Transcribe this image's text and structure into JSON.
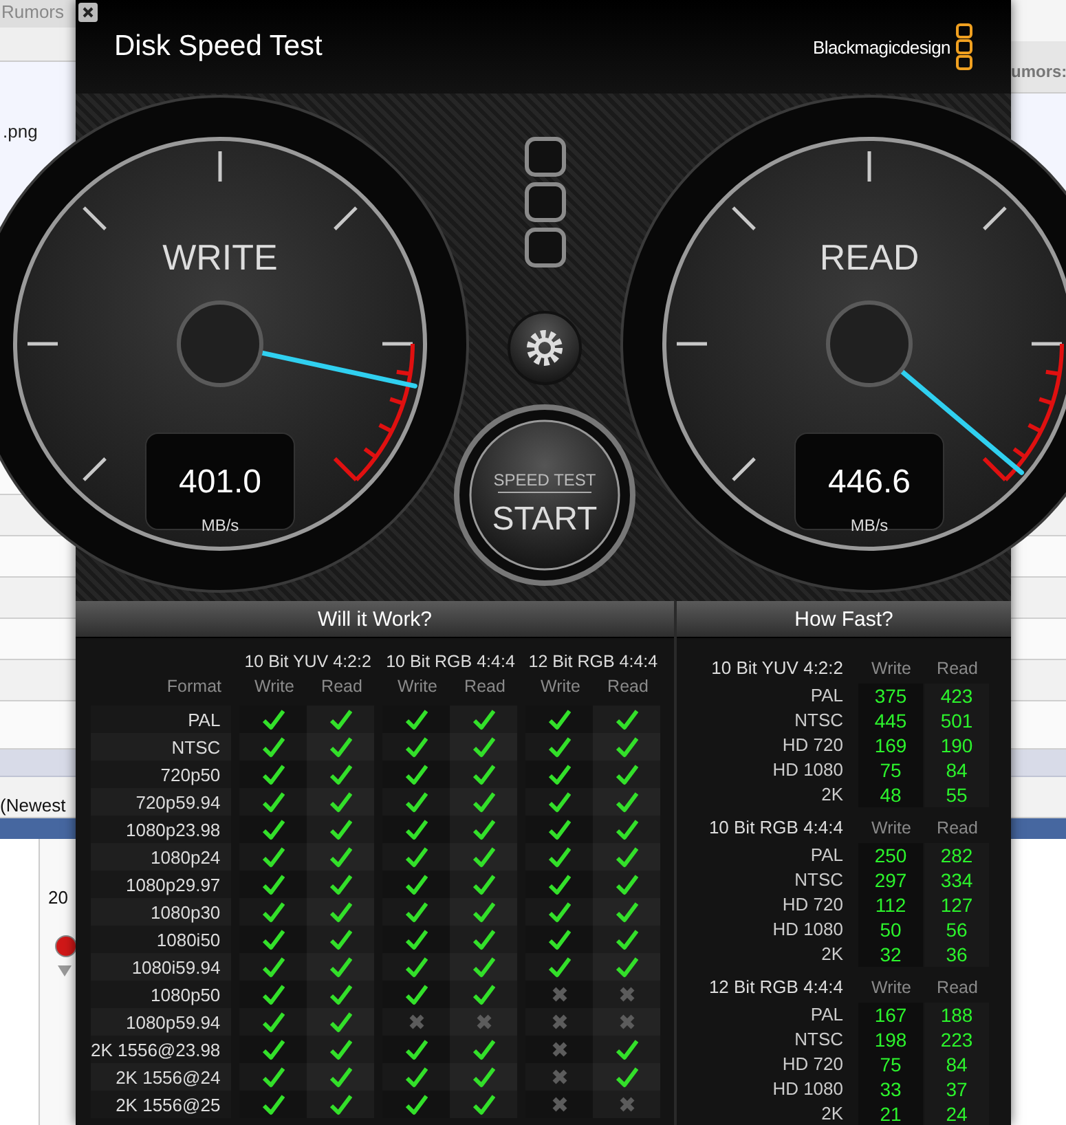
{
  "background_browser": {
    "tab_title": "Rumors",
    "file_name": ".png",
    "sort_label": "(Newest",
    "year_text": "20",
    "right_label": "umors:"
  },
  "window": {
    "title": "Disk Speed Test",
    "brand": "Blackmagicdesign"
  },
  "gauges": [
    {
      "label": "WRITE",
      "reading": "401.0",
      "unit": "MB/s"
    },
    {
      "label": "READ",
      "reading": "446.6",
      "unit": "MB/s"
    }
  ],
  "start_button": {
    "caption": "SPEED TEST",
    "label": "START"
  },
  "will_it_work": {
    "title": "Will it Work?",
    "format_header": "Format",
    "groups": [
      {
        "name": "10 Bit YUV 4:2:2",
        "columns": [
          "Write",
          "Read"
        ]
      },
      {
        "name": "10 Bit RGB 4:4:4",
        "columns": [
          "Write",
          "Read"
        ]
      },
      {
        "name": "12 Bit RGB 4:4:4",
        "columns": [
          "Write",
          "Read"
        ]
      }
    ],
    "rows": [
      {
        "format": "PAL",
        "results": [
          true,
          true,
          true,
          true,
          true,
          true
        ]
      },
      {
        "format": "NTSC",
        "results": [
          true,
          true,
          true,
          true,
          true,
          true
        ]
      },
      {
        "format": "720p50",
        "results": [
          true,
          true,
          true,
          true,
          true,
          true
        ]
      },
      {
        "format": "720p59.94",
        "results": [
          true,
          true,
          true,
          true,
          true,
          true
        ]
      },
      {
        "format": "1080p23.98",
        "results": [
          true,
          true,
          true,
          true,
          true,
          true
        ]
      },
      {
        "format": "1080p24",
        "results": [
          true,
          true,
          true,
          true,
          true,
          true
        ]
      },
      {
        "format": "1080p29.97",
        "results": [
          true,
          true,
          true,
          true,
          true,
          true
        ]
      },
      {
        "format": "1080p30",
        "results": [
          true,
          true,
          true,
          true,
          true,
          true
        ]
      },
      {
        "format": "1080i50",
        "results": [
          true,
          true,
          true,
          true,
          true,
          true
        ]
      },
      {
        "format": "1080i59.94",
        "results": [
          true,
          true,
          true,
          true,
          true,
          true
        ]
      },
      {
        "format": "1080p50",
        "results": [
          true,
          true,
          true,
          true,
          false,
          false
        ]
      },
      {
        "format": "1080p59.94",
        "results": [
          true,
          true,
          false,
          false,
          false,
          false
        ]
      },
      {
        "format": "2K 1556@23.98",
        "results": [
          true,
          true,
          true,
          true,
          false,
          true
        ]
      },
      {
        "format": "2K 1556@24",
        "results": [
          true,
          true,
          true,
          true,
          false,
          true
        ]
      },
      {
        "format": "2K 1556@25",
        "results": [
          true,
          true,
          true,
          true,
          false,
          false
        ]
      }
    ]
  },
  "how_fast": {
    "title": "How Fast?",
    "groups": [
      {
        "name": "10 Bit YUV 4:2:2",
        "write_header": "Write",
        "read_header": "Read",
        "rows": [
          {
            "format": "PAL",
            "write": "375",
            "read": "423"
          },
          {
            "format": "NTSC",
            "write": "445",
            "read": "501"
          },
          {
            "format": "HD 720",
            "write": "169",
            "read": "190"
          },
          {
            "format": "HD 1080",
            "write": "75",
            "read": "84"
          },
          {
            "format": "2K",
            "write": "48",
            "read": "55"
          }
        ]
      },
      {
        "name": "10 Bit RGB 4:4:4",
        "write_header": "Write",
        "read_header": "Read",
        "rows": [
          {
            "format": "PAL",
            "write": "250",
            "read": "282"
          },
          {
            "format": "NTSC",
            "write": "297",
            "read": "334"
          },
          {
            "format": "HD 720",
            "write": "112",
            "read": "127"
          },
          {
            "format": "HD 1080",
            "write": "50",
            "read": "56"
          },
          {
            "format": "2K",
            "write": "32",
            "read": "36"
          }
        ]
      },
      {
        "name": "12 Bit RGB 4:4:4",
        "write_header": "Write",
        "read_header": "Read",
        "rows": [
          {
            "format": "PAL",
            "write": "167",
            "read": "188"
          },
          {
            "format": "NTSC",
            "write": "198",
            "read": "223"
          },
          {
            "format": "HD 720",
            "write": "75",
            "read": "84"
          },
          {
            "format": "HD 1080",
            "write": "33",
            "read": "37"
          },
          {
            "format": "2K",
            "write": "21",
            "read": "24"
          }
        ]
      }
    ]
  }
}
